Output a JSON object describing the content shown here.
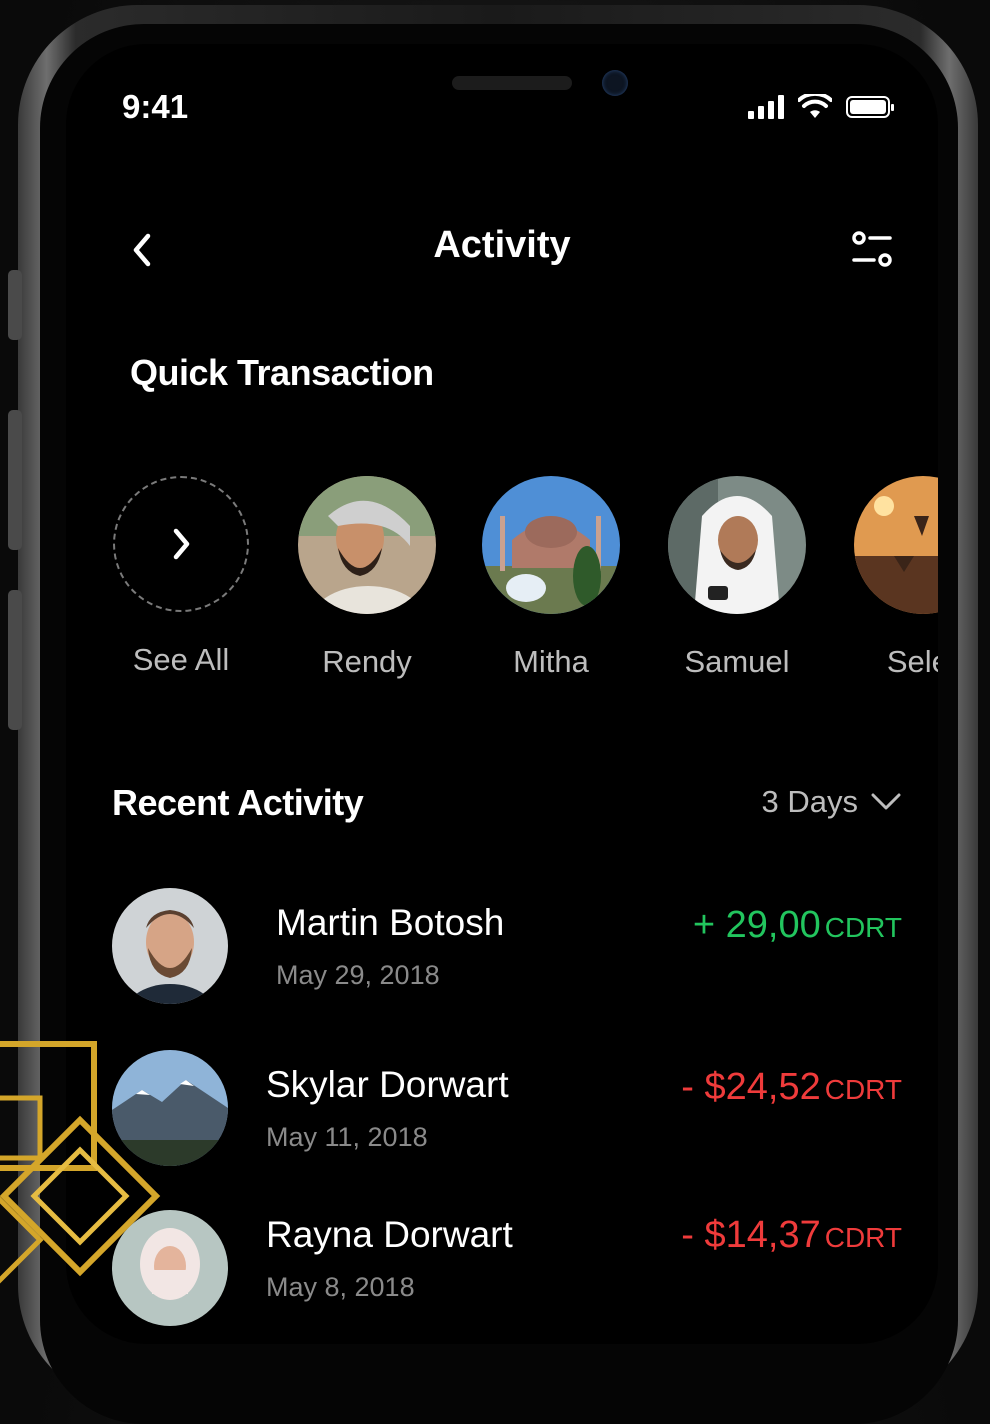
{
  "status_bar": {
    "time": "9:41"
  },
  "header": {
    "title": "Activity"
  },
  "quick_transaction": {
    "title": "Quick Transaction",
    "see_all_label": "See All",
    "contacts": [
      {
        "name": "Rendy"
      },
      {
        "name": "Mitha"
      },
      {
        "name": "Samuel"
      },
      {
        "name": "Seler"
      }
    ]
  },
  "recent_activity": {
    "title": "Recent Activity",
    "range_label": "3 Days",
    "items": [
      {
        "name": "Martin Botosh",
        "date": "May 29, 2018",
        "amount": "+ 29,00",
        "currency": "CDRT",
        "color": "#22c55e"
      },
      {
        "name": "Skylar Dorwart",
        "date": "May 11, 2018",
        "amount": "- $24,52",
        "currency": "CDRT",
        "color": "#ef3b3b"
      },
      {
        "name": "Rayna Dorwart",
        "date": "May 8, 2018",
        "amount": "- $14,37",
        "currency": "CDRT",
        "color": "#ef3b3b"
      }
    ]
  },
  "colors": {
    "positive": "#22c55e",
    "negative": "#ef3b3b",
    "background": "#000000",
    "decoration_gold": "#d4a62a"
  }
}
